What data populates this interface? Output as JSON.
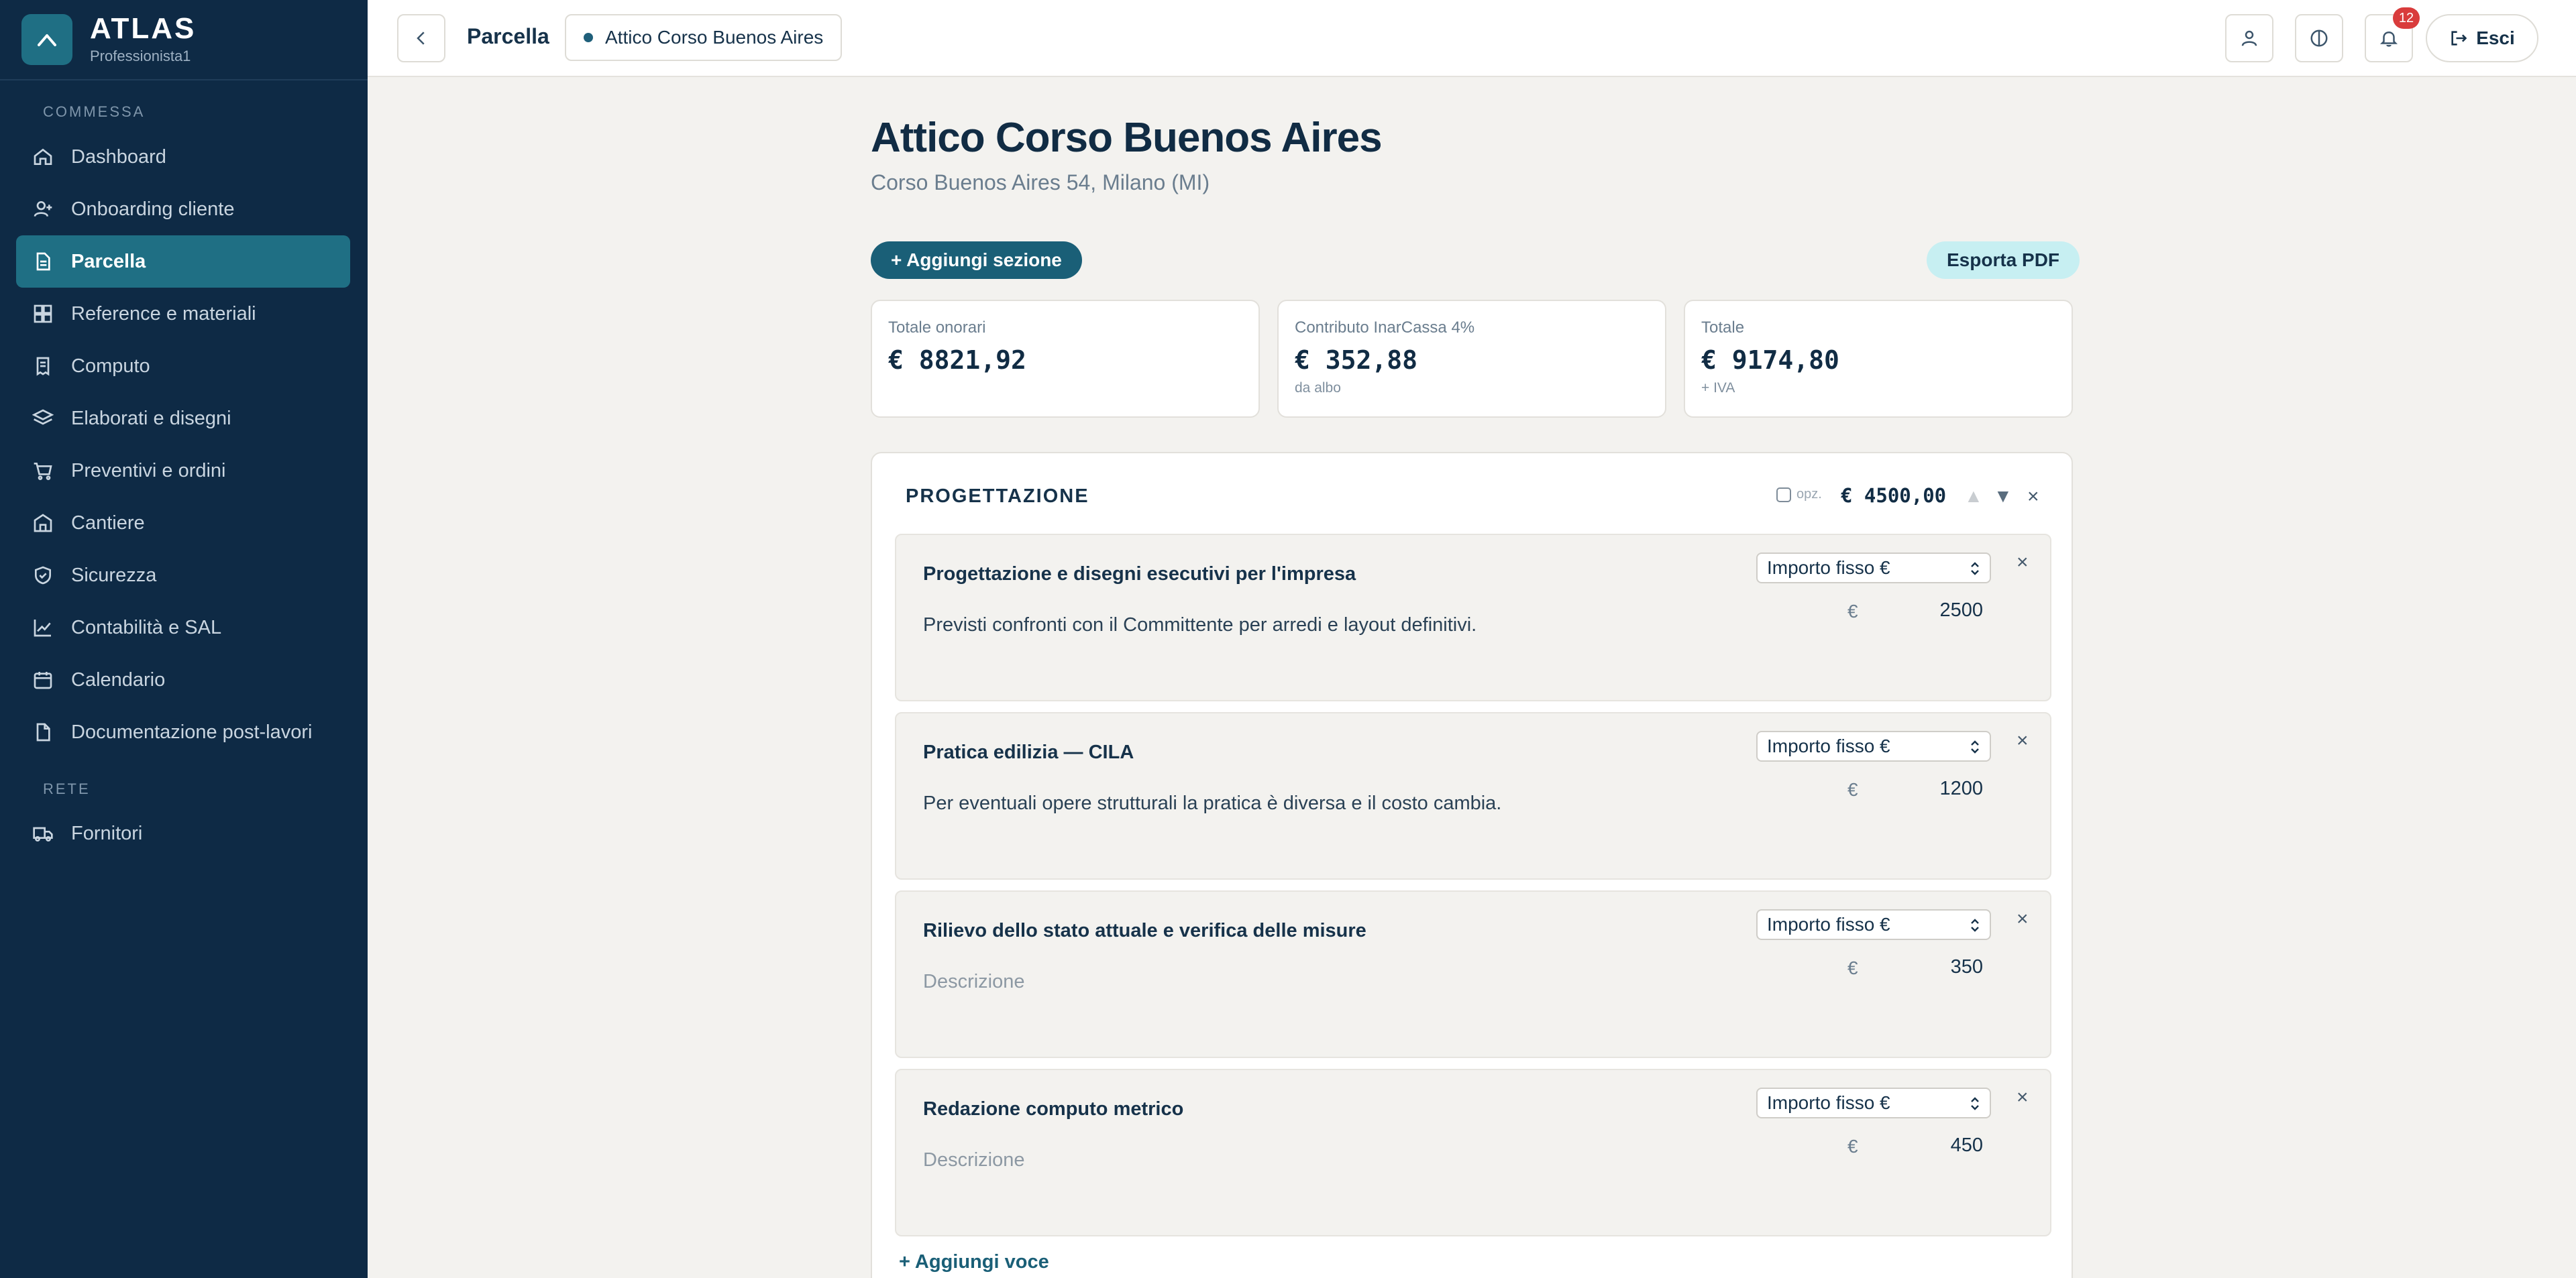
{
  "brand": {
    "name": "ATLAS",
    "user": "Professionista1"
  },
  "sidebar": {
    "section_commessa": "COMMESSA",
    "section_rete": "RETE",
    "items": [
      {
        "label": "Dashboard",
        "icon": "home-icon"
      },
      {
        "label": "Onboarding cliente",
        "icon": "user-plus-icon"
      },
      {
        "label": "Parcella",
        "icon": "document-icon",
        "active": true
      },
      {
        "label": "Reference e materiali",
        "icon": "grid-icon"
      },
      {
        "label": "Computo",
        "icon": "receipt-icon"
      },
      {
        "label": "Elaborati e disegni",
        "icon": "layers-icon"
      },
      {
        "label": "Preventivi e ordini",
        "icon": "cart-icon"
      },
      {
        "label": "Cantiere",
        "icon": "building-icon"
      },
      {
        "label": "Sicurezza",
        "icon": "shield-icon"
      },
      {
        "label": "Contabilità e SAL",
        "icon": "chart-icon"
      },
      {
        "label": "Calendario",
        "icon": "calendar-icon"
      },
      {
        "label": "Documentazione post-lavori",
        "icon": "file-icon"
      }
    ],
    "rete_items": [
      {
        "label": "Fornitori",
        "icon": "truck-icon"
      }
    ]
  },
  "topbar": {
    "title": "Parcella",
    "project": "Attico Corso Buenos Aires",
    "notifications_count": "12",
    "logout_label": "Esci"
  },
  "main": {
    "title": "Attico Corso Buenos Aires",
    "subtitle": "Corso Buenos Aires 54, Milano (MI)",
    "add_section_label": "+ Aggiungi sezione",
    "export_label": "Esporta PDF",
    "cards": [
      {
        "label": "Totale onorari",
        "value": "€ 8821,92",
        "note": ""
      },
      {
        "label": "Contributo InarCassa 4%",
        "value": "€ 352,88",
        "note": "da albo"
      },
      {
        "label": "Totale",
        "value": "€ 9174,80",
        "note": "+ IVA"
      }
    ],
    "section": {
      "title": "PROGETTAZIONE",
      "optional_label": "opz.",
      "total": "€ 4500,00",
      "add_item_label": "+ Aggiungi voce",
      "items": [
        {
          "title": "Progettazione e disegni esecutivi per l'impresa",
          "description": "Previsti confronti con il Committente per arredi e layout definitivi.",
          "pricing": "Importo fisso €",
          "currency": "€",
          "amount": "2500"
        },
        {
          "title": "Pratica edilizia — CILA",
          "description": "Per eventuali opere strutturali la pratica è diversa e il costo cambia.",
          "pricing": "Importo fisso €",
          "currency": "€",
          "amount": "1200"
        },
        {
          "title": "Rilievo dello stato attuale e verifica delle misure",
          "description": "",
          "placeholder": "Descrizione",
          "pricing": "Importo fisso €",
          "currency": "€",
          "amount": "350"
        },
        {
          "title": "Redazione computo metrico",
          "description": "",
          "placeholder": "Descrizione",
          "pricing": "Importo fisso €",
          "currency": "€",
          "amount": "450"
        }
      ]
    }
  },
  "colors": {
    "sidebar": "#0e2a45",
    "accent": "#1f6f84",
    "badge": "#d93c3c",
    "export": "#c7eff2"
  }
}
